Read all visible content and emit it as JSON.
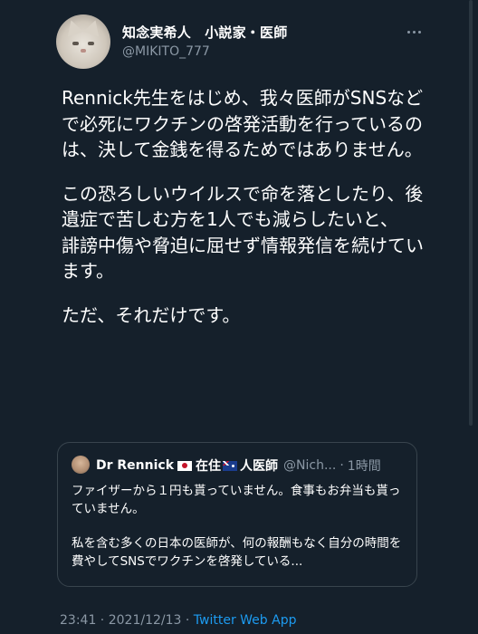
{
  "author": {
    "display_name": "知念実希人　小説家・医師",
    "handle": "@MIKITO_777"
  },
  "tweet": {
    "paragraphs": [
      "Rennick先生をはじめ、我々医師がSNSなどで必死にワクチンの啓発活動を行っているのは、決して金銭を得るためではありません。",
      "この恐ろしいウイルスで命を落としたり、後遺症で苦しむ方を1人でも減らしたいと、",
      "誹謗中傷や脅迫に屈せず情報発信を続けています。",
      "ただ、それだけです。"
    ]
  },
  "quote": {
    "name": "Dr Rennick",
    "name_suffix": "在住",
    "name_suffix2": "人医師",
    "handle": "@Nich...",
    "separator": "·",
    "time": "1時間",
    "paragraphs": [
      "ファイザーから１円も貰っていません。食事もお弁当も貰っていません。",
      "私を含む多くの日本の医師が、何の報酬もなく自分の時間を費やしてSNSでワクチンを啓発している..."
    ]
  },
  "meta": {
    "time": "23:41",
    "date": "2021/12/13",
    "dot1": " · ",
    "dot2": " · ",
    "client": "Twitter Web App"
  },
  "icons": {
    "more": "more-horizontal-icon",
    "flag1": "japan-flag-icon",
    "flag2": "australia-flag-icon"
  }
}
